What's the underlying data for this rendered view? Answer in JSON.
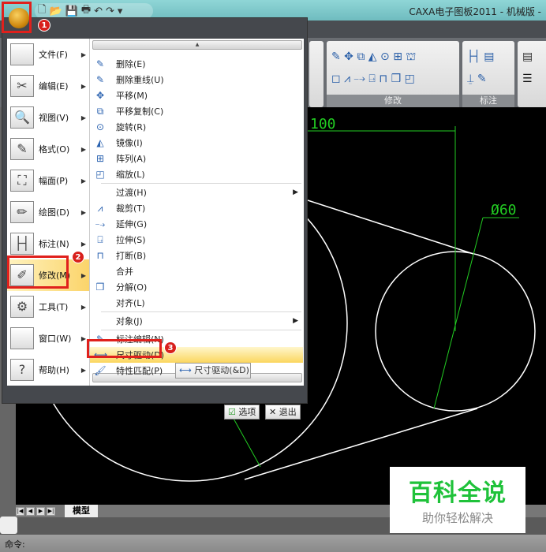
{
  "window": {
    "title": "CAXA电子图板2011 - 机械版 -"
  },
  "quick_access": {
    "icons": [
      "new-icon",
      "open-icon",
      "save-icon",
      "print-icon",
      "undo-icon",
      "redo-icon",
      "customize-icon"
    ],
    "glyphs": [
      "🗋",
      "📂",
      "💾",
      "🖶",
      "↶",
      "↷",
      "▾"
    ]
  },
  "ribbon": {
    "groups": [
      {
        "label": "修改"
      },
      {
        "label": "标注"
      }
    ]
  },
  "badges": [
    "1",
    "2",
    "3"
  ],
  "left_menu": [
    {
      "label": "文件(F)",
      "icon": "file-icon",
      "glyph": ""
    },
    {
      "label": "编辑(E)",
      "icon": "scissors-icon",
      "glyph": "✂"
    },
    {
      "label": "视图(V)",
      "icon": "magnifier-icon",
      "glyph": "🔍"
    },
    {
      "label": "格式(O)",
      "icon": "format-icon",
      "glyph": "✎"
    },
    {
      "label": "幅面(P)",
      "icon": "sheet-icon",
      "glyph": "⛶"
    },
    {
      "label": "绘图(D)",
      "icon": "draw-icon",
      "glyph": "✏"
    },
    {
      "label": "标注(N)",
      "icon": "dimension-icon",
      "glyph": "├┤"
    },
    {
      "label": "修改(M)",
      "icon": "modify-icon",
      "glyph": "✐"
    },
    {
      "label": "工具(T)",
      "icon": "gear-icon",
      "glyph": "⚙"
    },
    {
      "label": "窗口(W)",
      "icon": "window-icon",
      "glyph": ""
    },
    {
      "label": "帮助(H)",
      "icon": "help-icon",
      "glyph": "?"
    }
  ],
  "left_menu_active": "修改(M)",
  "submenu": [
    {
      "label": "删除(E)",
      "icon": "delete-icon",
      "glyph": "✎"
    },
    {
      "label": "删除重线(U)",
      "icon": "delete-duplicate-icon",
      "glyph": "✎"
    },
    {
      "label": "平移(M)",
      "icon": "move-icon",
      "glyph": "✥"
    },
    {
      "label": "平移复制(C)",
      "icon": "copy-move-icon",
      "glyph": "⧉"
    },
    {
      "label": "旋转(R)",
      "icon": "rotate-icon",
      "glyph": "⊙"
    },
    {
      "label": "镜像(I)",
      "icon": "mirror-icon",
      "glyph": "◭"
    },
    {
      "label": "阵列(A)",
      "icon": "array-icon",
      "glyph": "⊞"
    },
    {
      "label": "缩放(L)",
      "icon": "scale-icon",
      "glyph": "◰"
    },
    {
      "label": "过渡(H)",
      "icon": "",
      "glyph": "",
      "sub": true
    },
    {
      "label": "裁剪(T)",
      "icon": "trim-icon",
      "glyph": "⩘"
    },
    {
      "label": "延伸(G)",
      "icon": "extend-icon",
      "glyph": "⤍"
    },
    {
      "label": "拉伸(S)",
      "icon": "stretch-icon",
      "glyph": "⍈"
    },
    {
      "label": "打断(B)",
      "icon": "break-icon",
      "glyph": "⊓"
    },
    {
      "label": "合并",
      "icon": "",
      "glyph": ""
    },
    {
      "label": "分解(O)",
      "icon": "explode-icon",
      "glyph": "❒"
    },
    {
      "label": "对齐(L)",
      "icon": "",
      "glyph": ""
    },
    {
      "label": "对象(J)",
      "icon": "",
      "glyph": "",
      "sub": true
    },
    {
      "label": "标注编辑(N)",
      "icon": "dim-edit-icon",
      "glyph": "✎"
    },
    {
      "label": "尺寸驱动(D)",
      "icon": "dim-drive-icon",
      "glyph": "⟷",
      "highlighted": true
    },
    {
      "label": "特性匹配(P)",
      "icon": "match-prop-icon",
      "glyph": "🖌"
    }
  ],
  "tooltip": "尺寸驱动(&D)",
  "menu_buttons": {
    "options": "选项",
    "exit": "退出"
  },
  "drawing": {
    "dim_length": "100",
    "dim_diameter": "Ø60"
  },
  "tabs": {
    "model": "模型"
  },
  "command": {
    "label": "命令:"
  },
  "watermark": {
    "title": "百科全说",
    "subtitle": "助你轻松解决"
  },
  "colors": {
    "highlight": "#fbd65e",
    "annotation_red": "#e0201c",
    "dim_green": "#22cc22",
    "canvas": "#000000"
  }
}
